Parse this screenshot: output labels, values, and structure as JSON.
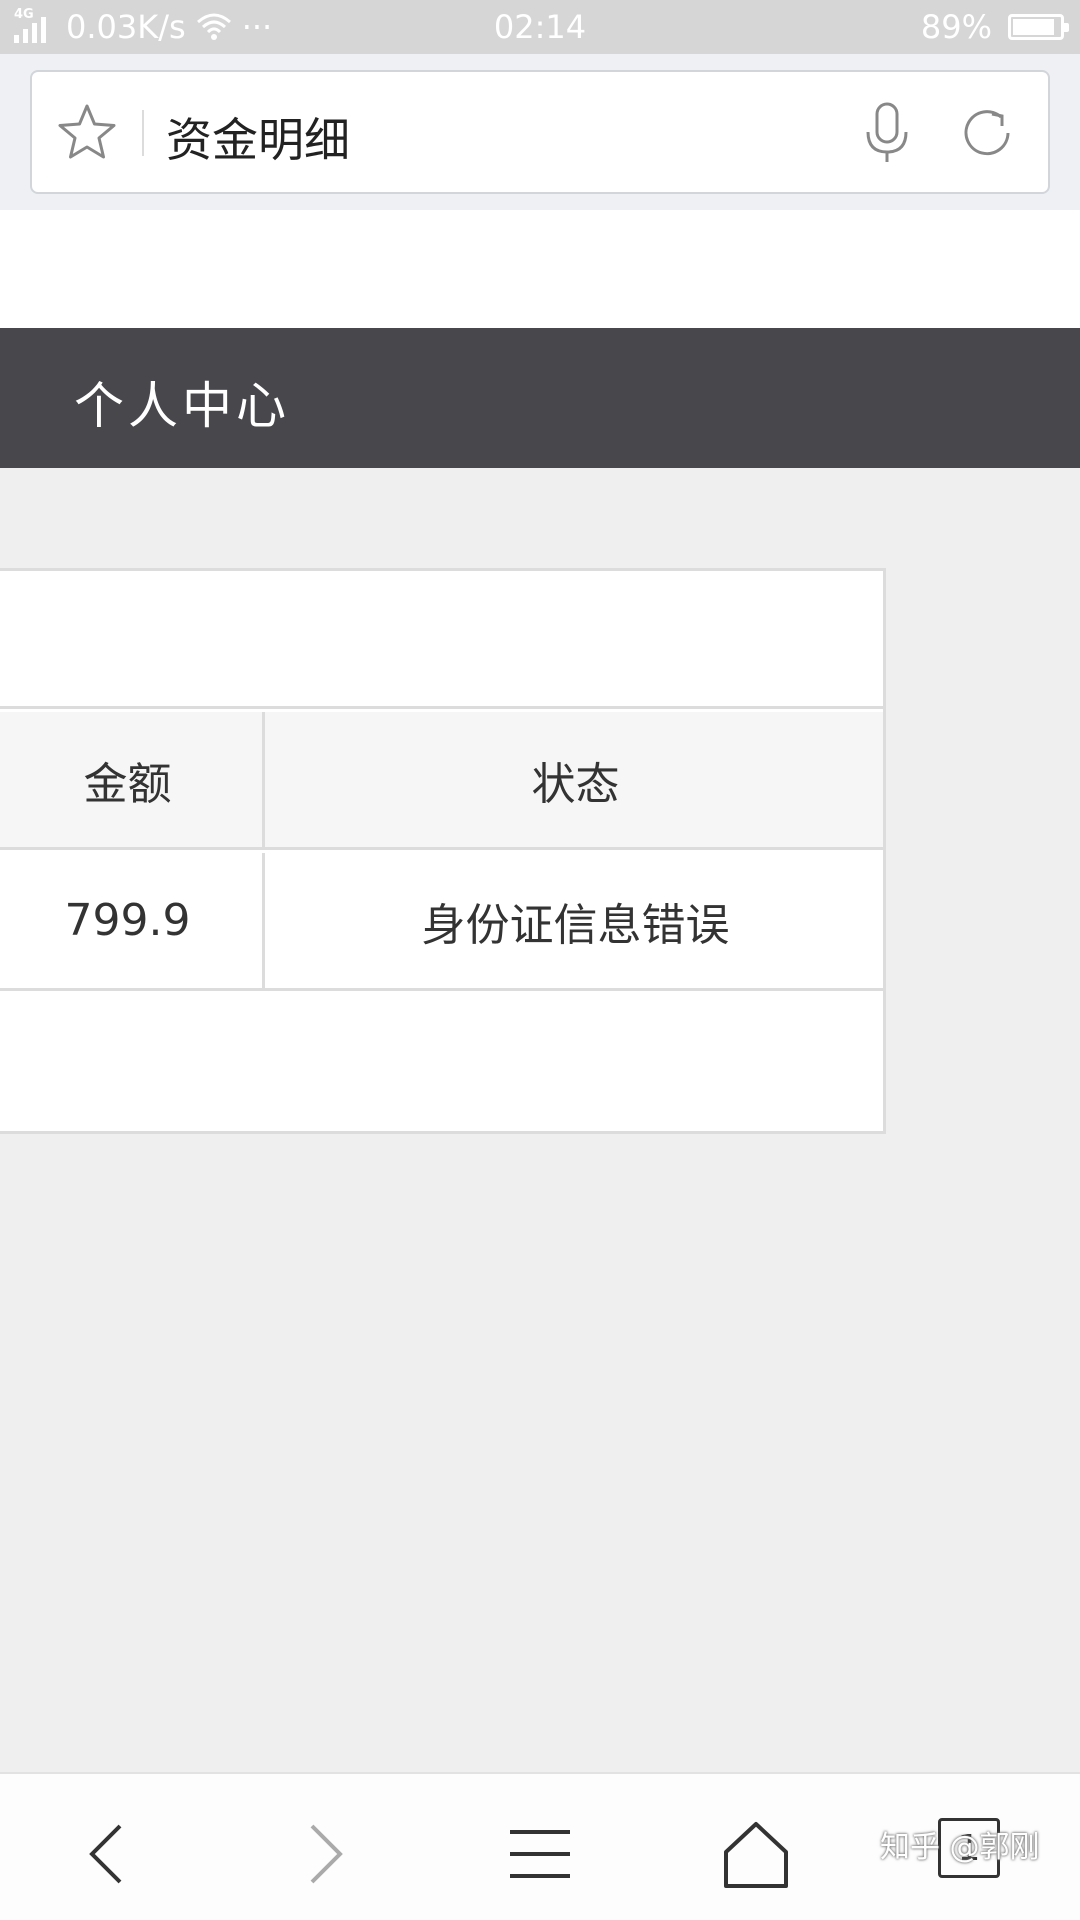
{
  "status_bar": {
    "network_type": "4G",
    "network_speed": "0.03K/s",
    "more_indicator": "···",
    "time": "02:14",
    "battery_percent": "89%",
    "battery_level": 0.89
  },
  "address_bar": {
    "page_title": "资金明细",
    "icons": [
      "star-icon",
      "microphone-icon",
      "reload-icon"
    ]
  },
  "header": {
    "title": "个人中心"
  },
  "table": {
    "columns": [
      "金额",
      "状态"
    ],
    "rows": [
      [
        "799.9",
        "身份证信息错误"
      ]
    ]
  },
  "bottom_nav": {
    "icons": [
      "back-arrow-icon",
      "forward-arrow-icon",
      "menu-icon",
      "home-icon",
      "tabs-icon"
    ],
    "tab_count": "1"
  },
  "watermark": "知乎 @郭刚"
}
